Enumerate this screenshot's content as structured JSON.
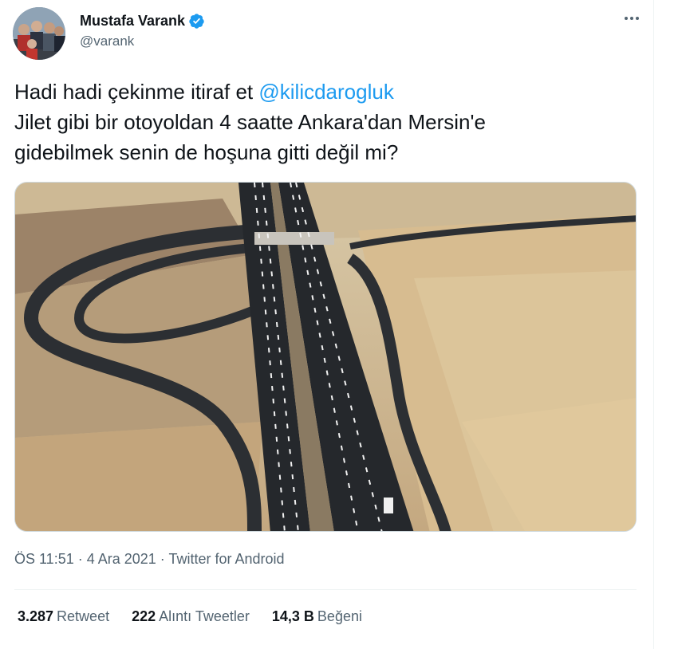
{
  "author": {
    "display_name": "Mustafa Varank",
    "handle": "@varank"
  },
  "tweet": {
    "text_line1_prefix": "Hadi hadi çekinme itiraf et ",
    "mention": "@kilicdarogluk",
    "text_line2": "Jilet gibi bir otoyoldan 4 saatte Ankara'dan Mersin'e",
    "text_line3": "gidebilmek senin de hoşuna gitti değil mi?"
  },
  "meta": {
    "time": "ÖS 11:51",
    "sep1": " · ",
    "date": "4 Ara 2021",
    "sep2": " · ",
    "source": "Twitter for Android"
  },
  "stats": {
    "retweets_count": "3.287",
    "retweets_label": "Retweet",
    "quotes_count": "222",
    "quotes_label": "Alıntı Tweetler",
    "likes_count": "14,3 B",
    "likes_label": "Beğeni"
  },
  "colors": {
    "accent": "#1d9bf0",
    "text": "#0f1419",
    "secondary": "#536471"
  },
  "icons": {
    "verified": "verified-badge-icon",
    "more": "more-options-icon"
  }
}
